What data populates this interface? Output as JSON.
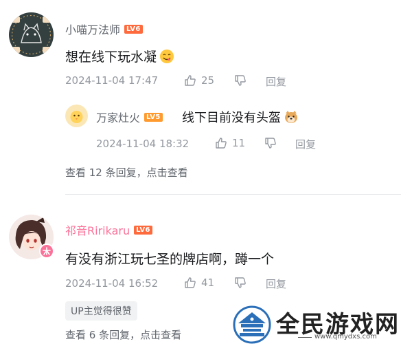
{
  "comments": [
    {
      "user": "小喵万法师",
      "level": "LV6",
      "text": "想在线下玩水凝",
      "time": "2024-11-04 17:47",
      "likes": "25",
      "reply_label": "回复",
      "replies": [
        {
          "user": "万家灶火",
          "level": "LV5",
          "text": "线下目前没有头盔",
          "time": "2024-11-04 18:32",
          "likes": "11",
          "reply_label": "回复"
        }
      ],
      "view_replies": "查看 12 条回复，点击查看"
    },
    {
      "user": "祁音Ririkaru",
      "level": "LV6",
      "text": "有没有浙江玩七圣的牌店啊，蹲一个",
      "time": "2024-11-04 16:52",
      "likes": "41",
      "reply_label": "回复",
      "badge": "UP主觉得很赞",
      "view_replies": "查看 6 条回复，点击查看"
    }
  ],
  "watermark": {
    "text": "全民游戏网",
    "url": "www.qmydxs.com"
  },
  "colors": {
    "level6": "#ff6a3d",
    "level5": "#ff9a2e",
    "vip_name": "#fb7299",
    "meta": "#9499a0"
  }
}
